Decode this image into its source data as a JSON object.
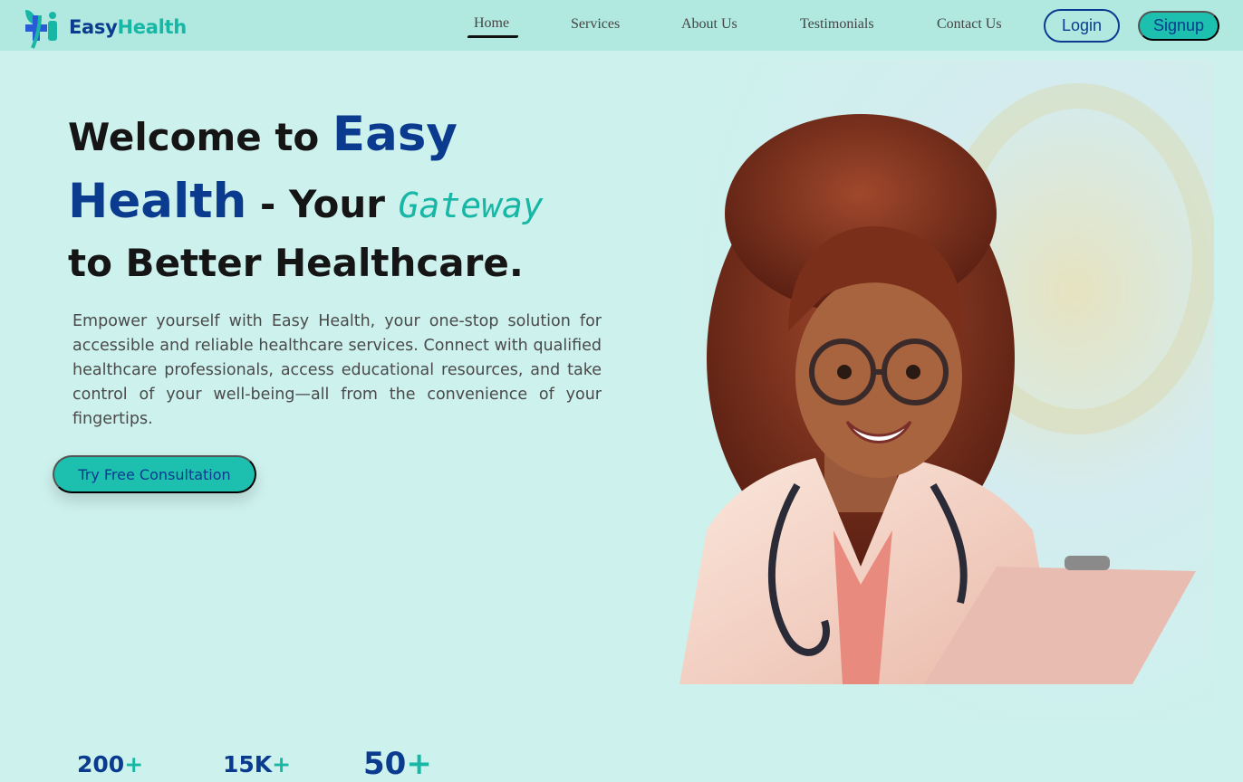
{
  "brand": {
    "easy": "Easy",
    "health": "Health"
  },
  "nav": {
    "links": [
      {
        "label": "Home",
        "active": true
      },
      {
        "label": "Services"
      },
      {
        "label": "About Us"
      },
      {
        "label": "Testimonials"
      },
      {
        "label": "Contact Us"
      }
    ],
    "login_label": "Login",
    "signup_label": "Signup"
  },
  "hero": {
    "welcome": "Welcome to ",
    "brand_easy": "Easy",
    "brand_health": "Health",
    "dash_your": " - Your ",
    "gateway": "Gateway",
    "line3": "to Better Healthcare.",
    "description": "Empower yourself with Easy Health, your one-stop solution for accessible and reliable healthcare services. Connect with qualified healthcare professionals, access educational resources, and take control of your well-being—all from the convenience of your fingertips.",
    "cta_label": "Try Free Consultation"
  },
  "stats": [
    {
      "value": "200",
      "suffix": "+"
    },
    {
      "value": "15K",
      "suffix": "+"
    },
    {
      "value": "50",
      "suffix": "+"
    }
  ],
  "colors": {
    "background": "#cdf1ed",
    "navbar": "#b1e9e1",
    "brand_blue": "#0b3b8f",
    "brand_teal": "#17b6a5",
    "button_teal": "#1dbfae"
  }
}
